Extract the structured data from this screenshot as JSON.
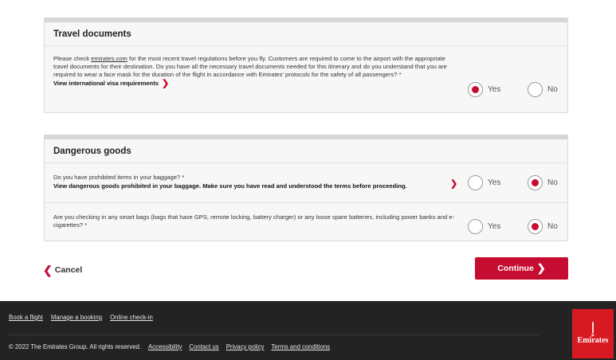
{
  "travel_documents": {
    "title": "Travel documents",
    "text_before_link": "Please check ",
    "link": "emirates.com",
    "text_after_link": " for the most recent travel regulations before you fly. Customers are required to come to the airport with the appropriate travel documents for their destination. Do you have all the necessary travel documents needed for this itinerary and do you understand that you are required to wear a face mask for the duration of the flight in accordance with Emirates' protocols for the safety of all passengers? *",
    "visa_link": "View international visa requirements",
    "yes_label": "Yes",
    "no_label": "No",
    "selected": "Yes"
  },
  "dangerous_goods": {
    "title": "Dangerous goods",
    "q1": {
      "text": "Do you have prohibited items in your baggage? *",
      "bold": "View dangerous goods prohibited in your baggage. Make sure you have read and understood the terms before proceeding.",
      "yes_label": "Yes",
      "no_label": "No",
      "selected": "No"
    },
    "q2": {
      "text": "Are you checking in any smart bags (bags that have GPS, remote locking, battery charger) or any loose spare batteries, including power banks and e-cigarettes? *",
      "yes_label": "Yes",
      "no_label": "No",
      "selected": "No"
    }
  },
  "actions": {
    "cancel": "Cancel",
    "continue": "Continue"
  },
  "footer": {
    "top_links": [
      "Book a flight",
      "Manage a booking",
      "Online check-in"
    ],
    "copyright": "© 2022 The Emirates Group. All rights reserved.",
    "bottom_links": [
      "Accessibility",
      "Contact us",
      "Privacy policy",
      "Terms and conditions"
    ],
    "logo_text": "Emirates"
  },
  "colors": {
    "accent": "#c60c30",
    "footer_bg": "#232323",
    "logo_bg": "#d71921"
  }
}
